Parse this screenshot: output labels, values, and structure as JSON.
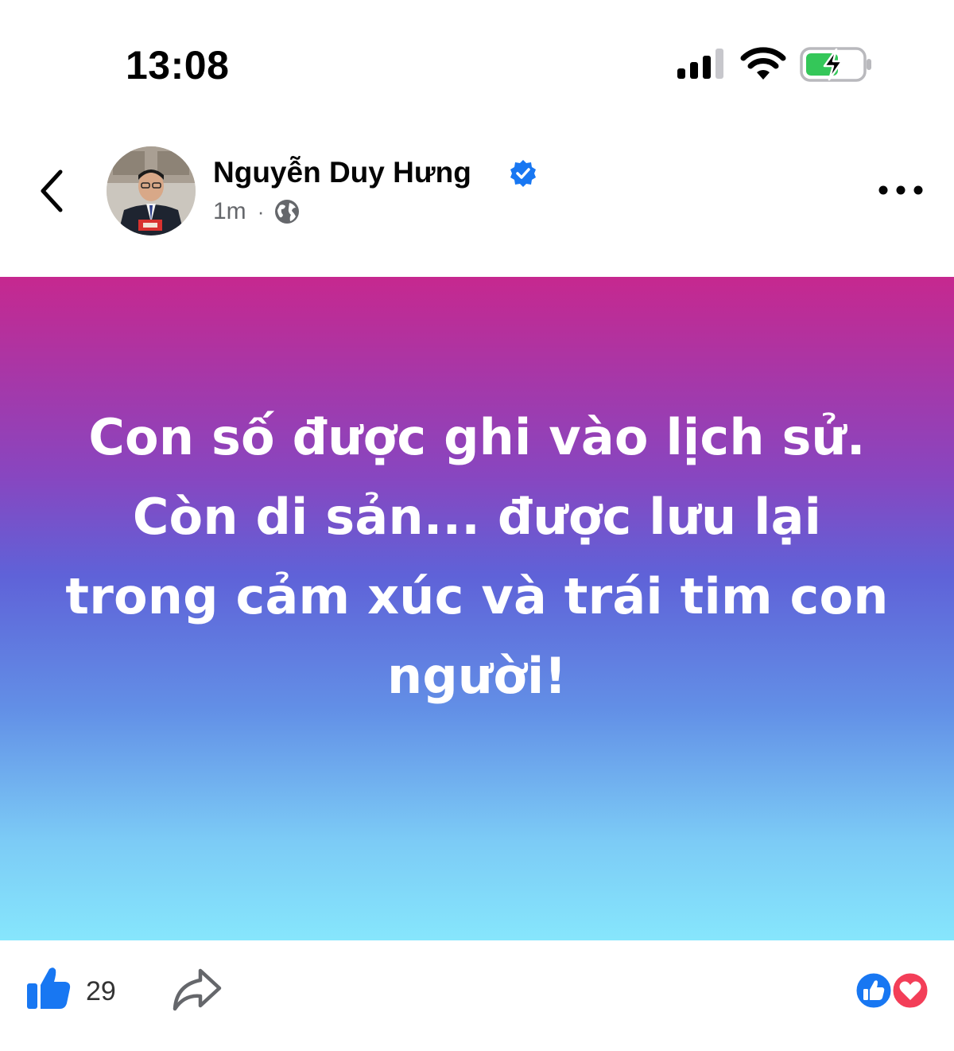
{
  "status_bar": {
    "time": "13:08",
    "icons": [
      "signal-icon",
      "wifi-icon",
      "battery-charging-icon"
    ]
  },
  "post": {
    "author": "Nguyễn Duy Hưng",
    "verified": true,
    "time": "1m",
    "separator": "·",
    "audience_icon": "globe-icon",
    "text": "Con số được ghi vào lịch sử.\nCòn di sản... được lưu lại trong cảm xúc và trái tim con người!",
    "background_gradient": [
      "#c6288f",
      "#8846c0",
      "#5f62d8",
      "#628fe6",
      "#7ccbf6",
      "#86e6fc"
    ]
  },
  "actions": {
    "like_count": "29",
    "reaction_icons": [
      "like-reaction-icon",
      "love-reaction-icon"
    ]
  },
  "colors": {
    "facebook_blue": "#1877f2",
    "love_red": "#f33e58",
    "battery_green": "#34c759",
    "meta_gray": "#65676b"
  }
}
